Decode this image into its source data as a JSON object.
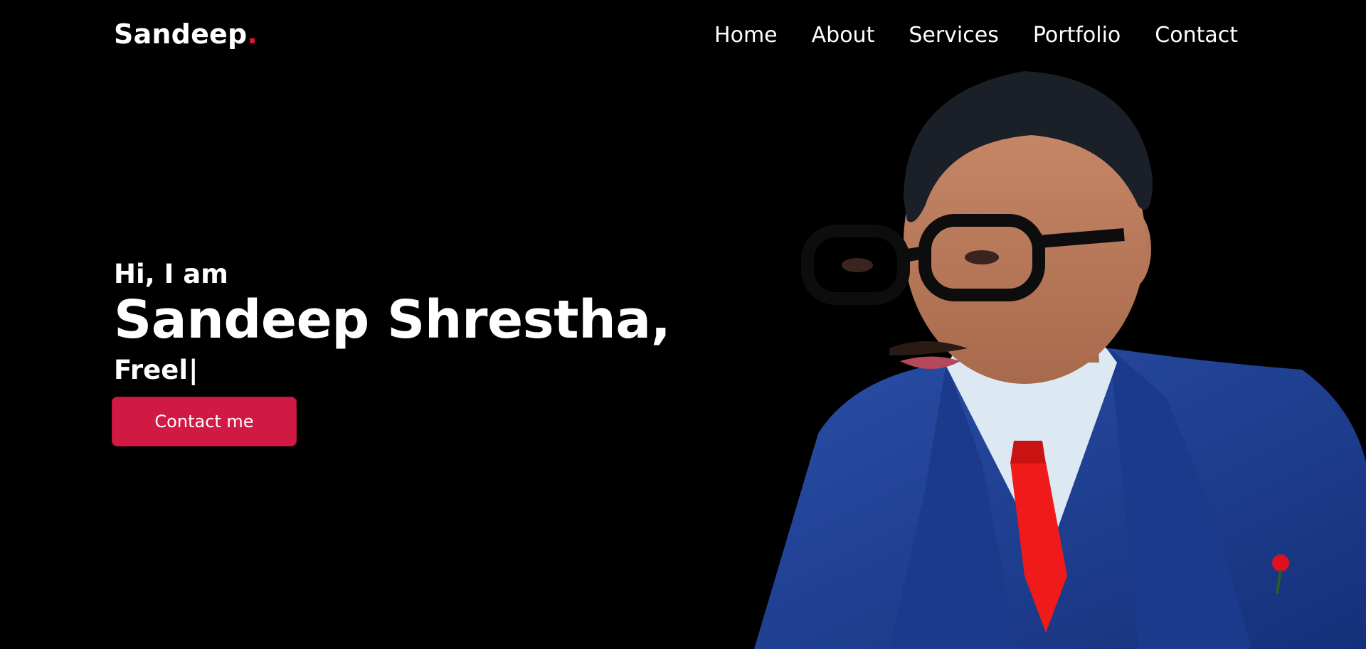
{
  "brand": {
    "name": "Sandeep",
    "dot": ".",
    "accent": "#dc143c"
  },
  "nav": {
    "items": [
      {
        "label": "Home"
      },
      {
        "label": "About"
      },
      {
        "label": "Services"
      },
      {
        "label": "Portfolio"
      },
      {
        "label": "Contact"
      }
    ]
  },
  "hero": {
    "intro": "Hi, I am",
    "name": "Sandeep Shrestha,",
    "typed": "Freel",
    "cursor": "|",
    "cta_label": "Contact me",
    "cta_color": "#d01a44"
  },
  "portrait": {
    "icon": "portrait-photo"
  }
}
